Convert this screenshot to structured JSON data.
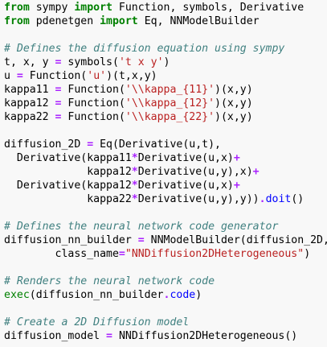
{
  "editor": {
    "lines": [
      [
        {
          "t": "from",
          "c": "kw"
        },
        {
          "t": " sympy ",
          "c": "tx"
        },
        {
          "t": "import",
          "c": "kw"
        },
        {
          "t": " Function, symbols, Derivative",
          "c": "tx"
        }
      ],
      [
        {
          "t": "from",
          "c": "kw"
        },
        {
          "t": " pdenetgen ",
          "c": "tx"
        },
        {
          "t": "import",
          "c": "kw"
        },
        {
          "t": " Eq, NNModelBuilder",
          "c": "tx"
        }
      ],
      [],
      [
        {
          "t": "# Defines the diffusion equation using sympy",
          "c": "cm"
        }
      ],
      [
        {
          "t": "t, x, y ",
          "c": "tx"
        },
        {
          "t": "=",
          "c": "op"
        },
        {
          "t": " symbols(",
          "c": "tx"
        },
        {
          "t": "'t x y'",
          "c": "st"
        },
        {
          "t": ")",
          "c": "tx"
        }
      ],
      [
        {
          "t": "u ",
          "c": "tx"
        },
        {
          "t": "=",
          "c": "op"
        },
        {
          "t": " Function(",
          "c": "tx"
        },
        {
          "t": "'u'",
          "c": "st"
        },
        {
          "t": ")(t,x,y)",
          "c": "tx"
        }
      ],
      [
        {
          "t": "kappa11 ",
          "c": "tx"
        },
        {
          "t": "=",
          "c": "op"
        },
        {
          "t": " Function(",
          "c": "tx"
        },
        {
          "t": "'\\\\kappa_{11}'",
          "c": "st"
        },
        {
          "t": ")(x,y)",
          "c": "tx"
        }
      ],
      [
        {
          "t": "kappa12 ",
          "c": "tx"
        },
        {
          "t": "=",
          "c": "op"
        },
        {
          "t": " Function(",
          "c": "tx"
        },
        {
          "t": "'\\\\kappa_{12}'",
          "c": "st"
        },
        {
          "t": ")(x,y)",
          "c": "tx"
        }
      ],
      [
        {
          "t": "kappa22 ",
          "c": "tx"
        },
        {
          "t": "=",
          "c": "op"
        },
        {
          "t": " Function(",
          "c": "tx"
        },
        {
          "t": "'\\\\kappa_{22}'",
          "c": "st"
        },
        {
          "t": ")(x,y)",
          "c": "tx"
        }
      ],
      [],
      [
        {
          "t": "diffusion_2D ",
          "c": "tx"
        },
        {
          "t": "=",
          "c": "op"
        },
        {
          "t": " Eq(Derivative(u,t),",
          "c": "tx"
        }
      ],
      [
        {
          "t": "  Derivative(kappa11",
          "c": "tx"
        },
        {
          "t": "*",
          "c": "op"
        },
        {
          "t": "Derivative(u,x)",
          "c": "tx"
        },
        {
          "t": "+",
          "c": "op"
        }
      ],
      [
        {
          "t": "             kappa12",
          "c": "tx"
        },
        {
          "t": "*",
          "c": "op"
        },
        {
          "t": "Derivative(u,y),x)",
          "c": "tx"
        },
        {
          "t": "+",
          "c": "op"
        }
      ],
      [
        {
          "t": "  Derivative(kappa12",
          "c": "tx"
        },
        {
          "t": "*",
          "c": "op"
        },
        {
          "t": "Derivative(u,x)",
          "c": "tx"
        },
        {
          "t": "+",
          "c": "op"
        }
      ],
      [
        {
          "t": "             kappa22",
          "c": "tx"
        },
        {
          "t": "*",
          "c": "op"
        },
        {
          "t": "Derivative(u,y),y))",
          "c": "tx"
        },
        {
          "t": ".",
          "c": "op"
        },
        {
          "t": "doit",
          "c": "nf"
        },
        {
          "t": "()",
          "c": "tx"
        }
      ],
      [],
      [
        {
          "t": "# Defines the neural network code generator",
          "c": "cm"
        }
      ],
      [
        {
          "t": "diffusion_nn_builder ",
          "c": "tx"
        },
        {
          "t": "=",
          "c": "op"
        },
        {
          "t": " NNModelBuilder(diffusion_2D,",
          "c": "tx"
        }
      ],
      [
        {
          "t": "        class_name",
          "c": "tx"
        },
        {
          "t": "=",
          "c": "op"
        },
        {
          "t": "\"NNDiffusion2DHeterogeneous\"",
          "c": "st"
        },
        {
          "t": ")",
          "c": "tx"
        }
      ],
      [],
      [
        {
          "t": "# Renders the neural network code",
          "c": "cm"
        }
      ],
      [
        {
          "t": "exec",
          "c": "bi"
        },
        {
          "t": "(diffusion_nn_builder",
          "c": "tx"
        },
        {
          "t": ".",
          "c": "op"
        },
        {
          "t": "code",
          "c": "nf"
        },
        {
          "t": ")",
          "c": "tx"
        }
      ],
      [],
      [
        {
          "t": "# Create a 2D Diffusion model",
          "c": "cm"
        }
      ],
      [
        {
          "t": "diffusion_model ",
          "c": "tx"
        },
        {
          "t": "=",
          "c": "op"
        },
        {
          "t": " NNDiffusion2DHeterogeneous()",
          "c": "tx"
        }
      ]
    ]
  },
  "colors": {
    "background": "#f8f8f8",
    "keyword": "#008000",
    "comment": "#408080",
    "string": "#ba2121",
    "operator": "#aa22ff",
    "function": "#0000ff"
  }
}
